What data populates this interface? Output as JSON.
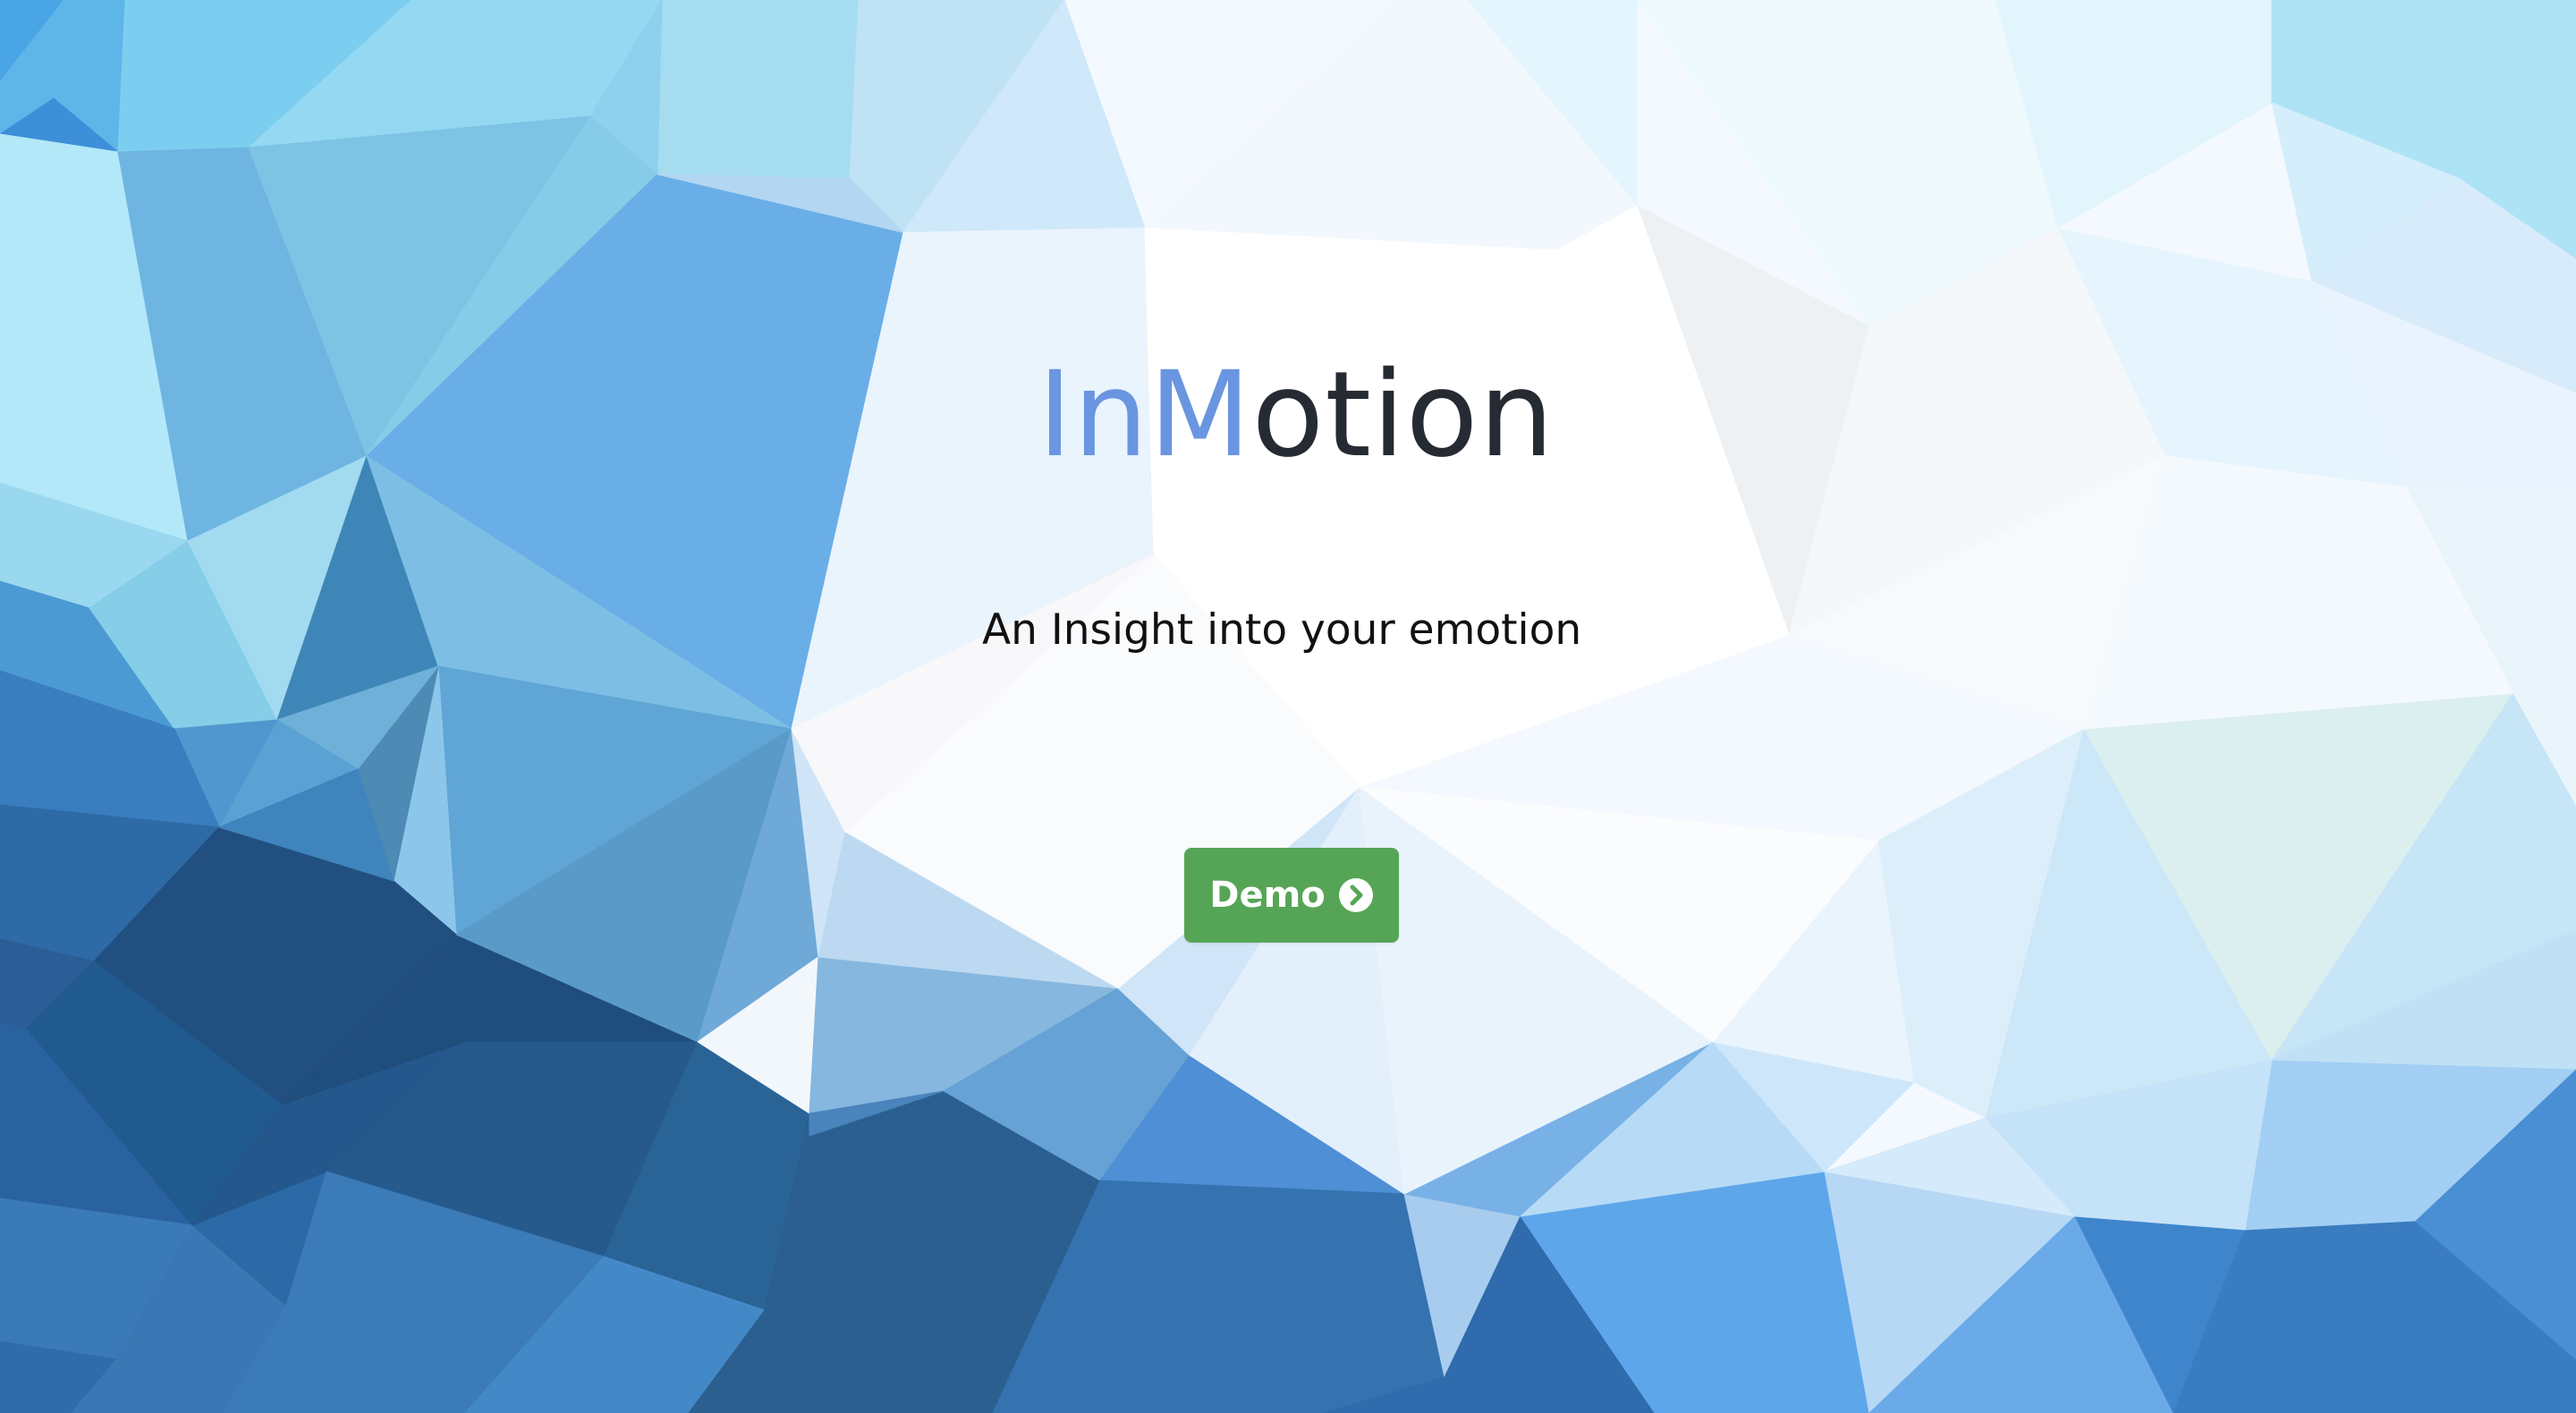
{
  "hero": {
    "title_part1": "In",
    "title_part2": "M",
    "title_part3": "otion",
    "tagline": "An Insight into your emotion",
    "demo_label": "Demo",
    "demo_icon": "chevron-circle-right-icon"
  },
  "colors": {
    "accent": "#6a95e0",
    "title": "#262a33",
    "button": "#56a556",
    "button_text": "#ffffff"
  }
}
